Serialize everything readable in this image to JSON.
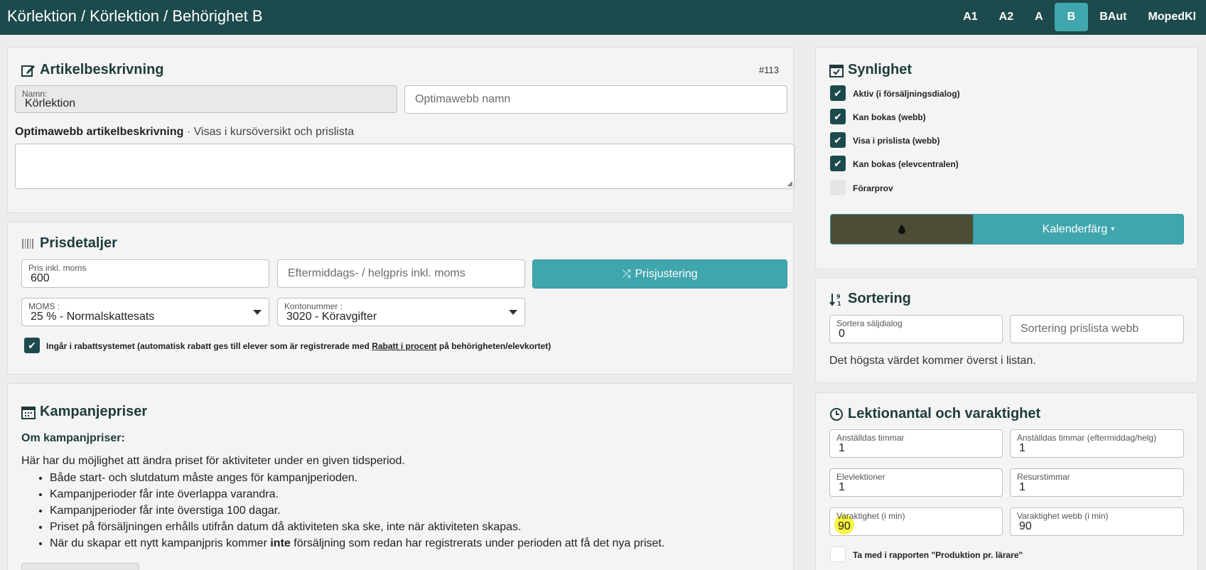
{
  "header": {
    "title": "Körlektion / Körlektion / Behörighet B",
    "nav": [
      "A1",
      "A2",
      "A",
      "B",
      "BAut",
      "MopedKl"
    ],
    "active": "B"
  },
  "article": {
    "heading": "Artikelbeskrivning",
    "id": "#113",
    "name_label": "Namn:",
    "name_value": "Körlektion",
    "optima_name_placeholder": "Optimawebb namn",
    "desc_label_bold": "Optimawebb artikelbeskrivning",
    "desc_label_rest": " · Visas i kursöversikt och prislista"
  },
  "pricing": {
    "heading": "Prisdetaljer",
    "price_label": "Pris inkl. moms",
    "price_value": "600",
    "afternoon_placeholder": "Eftermiddags- / helgpris inkl. moms",
    "adjust_button": "Prisjustering",
    "vat_label": "MOMS :",
    "vat_value": "25 % - Normalskattesats",
    "account_label": "Kontonummer :",
    "account_value": "3020 - Köravgifter",
    "discount_text_1": "Ingår i rabattsystemet (automatisk rabatt ges till elever som är registrerade med ",
    "discount_link": "Rabatt i procent",
    "discount_text_2": " på behörigheten/elevkortet)"
  },
  "campaign": {
    "heading": "Kampanjepriser",
    "subheading": "Om kampanjpriser:",
    "intro": "Här har du möjlighet att ändra priset för aktiviteter under en given tidsperiod.",
    "bullets": [
      "Både start- och slutdatum måste anges för kampanjperioden.",
      "Kampanjperioder får inte överlappa varandra.",
      "Kampanjperioder får inte överstiga 100 dagar.",
      "Priset på försäljningen erhålls utifrån datum då aktiviteten ska ske, inte när aktiviteten skapas."
    ],
    "last_bullet_pre": "När du skapar ett nytt kampanjpris kommer ",
    "last_bullet_bold": "inte",
    "last_bullet_post": " försäljning som redan har registrerats under perioden att få det nya priset."
  },
  "visibility": {
    "heading": "Synlighet",
    "items": [
      {
        "label": "Aktiv (i försäljningsdialog)",
        "checked": true
      },
      {
        "label": "Kan bokas (webb)",
        "checked": true
      },
      {
        "label": "Visa i prislista (webb)",
        "checked": true
      },
      {
        "label": "Kan bokas (elevcentralen)",
        "checked": true
      },
      {
        "label": "Förarprov",
        "checked": false
      }
    ],
    "swatch_color": "#4d4d35",
    "calendar_button": "Kalenderfärg"
  },
  "sorting": {
    "heading": "Sortering",
    "sales_label": "Sortera säljdialog",
    "sales_value": "0",
    "web_placeholder": "Sortering prislista webb",
    "note": "Det högsta värdet kommer överst i listan."
  },
  "lessons": {
    "heading": "Lektionantal och varaktighet",
    "fields": [
      {
        "label": "Anställdas timmar",
        "value": "1"
      },
      {
        "label": "Anställdas timmar (eftermiddag/helg)",
        "value": "1"
      },
      {
        "label": "Elevlektioner",
        "value": "1"
      },
      {
        "label": "Resurstimmar",
        "value": "1"
      },
      {
        "label": "Varaktighet (i min)",
        "value": "90"
      },
      {
        "label": "Varaktighet webb (i min)",
        "value": "90"
      }
    ],
    "report_label": "Ta med i rapporten \"Produktion pr. lärare\""
  },
  "colors": {
    "header_bg": "#1d4a4c",
    "accent": "#40a6ad",
    "highlight": "#f6f31f"
  }
}
